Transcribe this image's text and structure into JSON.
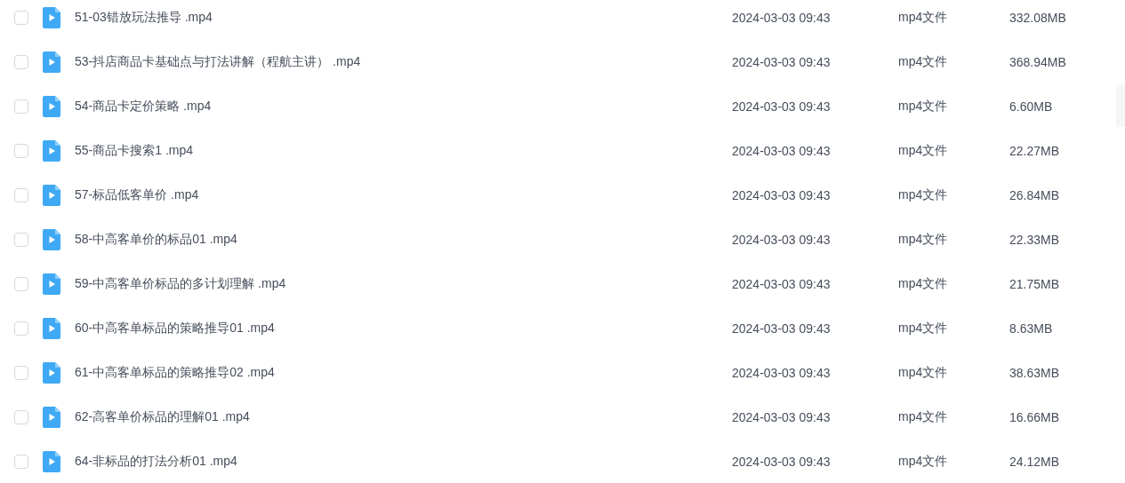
{
  "files": [
    {
      "name": "51-03错放玩法推导 .mp4",
      "date": "2024-03-03 09:43",
      "type": "mp4文件",
      "size": "332.08MB",
      "checked": false
    },
    {
      "name": "53-抖店商品卡基础点与打法讲解（程航主讲） .mp4",
      "date": "2024-03-03 09:43",
      "type": "mp4文件",
      "size": "368.94MB",
      "checked": false
    },
    {
      "name": "54-商品卡定价策略 .mp4",
      "date": "2024-03-03 09:43",
      "type": "mp4文件",
      "size": "6.60MB",
      "checked": false
    },
    {
      "name": "55-商品卡搜索1 .mp4",
      "date": "2024-03-03 09:43",
      "type": "mp4文件",
      "size": "22.27MB",
      "checked": false
    },
    {
      "name": "57-标品低客单价 .mp4",
      "date": "2024-03-03 09:43",
      "type": "mp4文件",
      "size": "26.84MB",
      "checked": false
    },
    {
      "name": "58-中高客单价的标品01 .mp4",
      "date": "2024-03-03 09:43",
      "type": "mp4文件",
      "size": "22.33MB",
      "checked": false
    },
    {
      "name": "59-中高客单价标品的多计划理解 .mp4",
      "date": "2024-03-03 09:43",
      "type": "mp4文件",
      "size": "21.75MB",
      "checked": false
    },
    {
      "name": "60-中高客单标品的策略推导01 .mp4",
      "date": "2024-03-03 09:43",
      "type": "mp4文件",
      "size": "8.63MB",
      "checked": false
    },
    {
      "name": "61-中高客单标品的策略推导02 .mp4",
      "date": "2024-03-03 09:43",
      "type": "mp4文件",
      "size": "38.63MB",
      "checked": false
    },
    {
      "name": "62-高客单价标品的理解01 .mp4",
      "date": "2024-03-03 09:43",
      "type": "mp4文件",
      "size": "16.66MB",
      "checked": false
    },
    {
      "name": "64-非标品的打法分析01 .mp4",
      "date": "2024-03-03 09:43",
      "type": "mp4文件",
      "size": "24.12MB",
      "checked": false
    }
  ]
}
